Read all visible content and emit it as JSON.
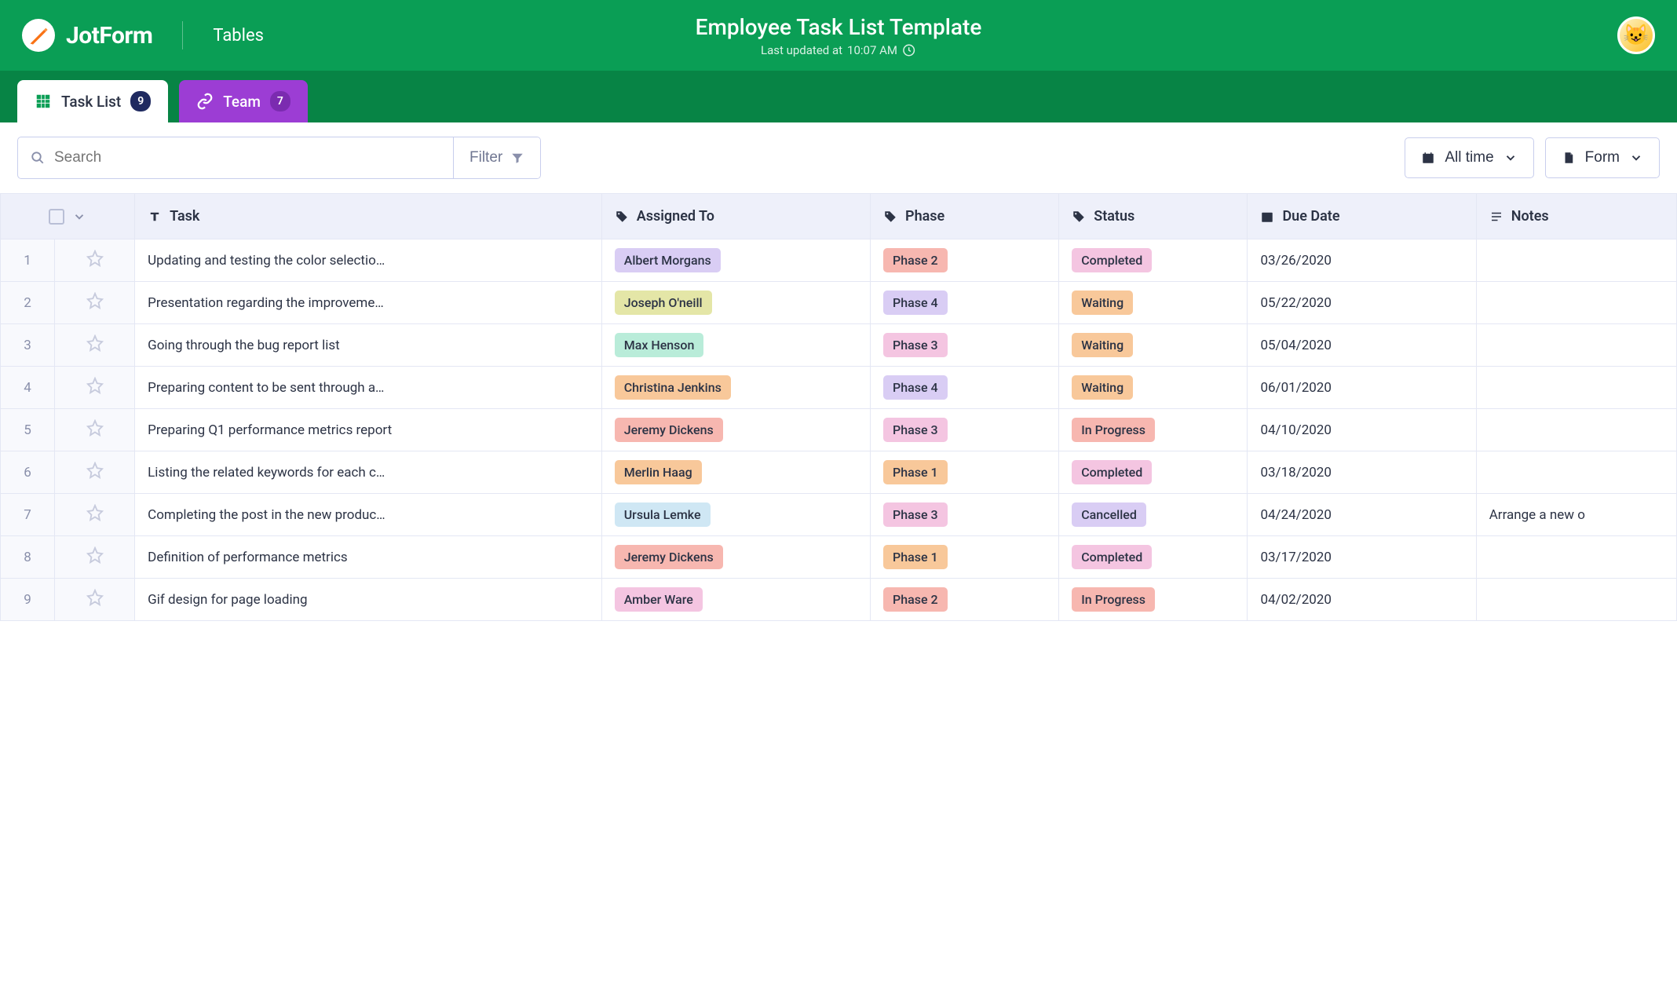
{
  "brand": {
    "name": "JotForm",
    "section": "Tables"
  },
  "header": {
    "title": "Employee Task List Template",
    "last_updated_prefix": "Last updated at ",
    "last_updated_time": "10:07 AM"
  },
  "tabs": {
    "task_list": {
      "label": "Task List",
      "count": "9"
    },
    "team": {
      "label": "Team",
      "count": "7"
    }
  },
  "toolbar": {
    "search_placeholder": "Search",
    "filter_label": "Filter",
    "timerange_label": "All time",
    "form_label": "Form"
  },
  "columns": {
    "task": "Task",
    "assigned_to": "Assigned To",
    "phase": "Phase",
    "status": "Status",
    "due_date": "Due Date",
    "notes": "Notes"
  },
  "colors": {
    "assignee": {
      "Albert Morgans": "#d9cdf4",
      "Joseph O'neill": "#e4e6a7",
      "Max Henson": "#b9ecd9",
      "Christina Jenkins": "#f8c89a",
      "Jeremy Dickens": "#f7b7b0",
      "Merlin Haag": "#f8c89a",
      "Ursula Lemke": "#cfe7f4",
      "Amber Ware": "#f4c5e1"
    },
    "phase": {
      "Phase 1": "#f8c89a",
      "Phase 2": "#f7b7b0",
      "Phase 3": "#f4c5e1",
      "Phase 4": "#d9cdf4"
    },
    "status": {
      "Completed": "#f4c5e1",
      "Waiting": "#f8c89a",
      "In Progress": "#f7b7b0",
      "Cancelled": "#d9cdf4"
    }
  },
  "rows": [
    {
      "idx": "1",
      "task": "Updating and testing the color selectio…",
      "assignee": "Albert Morgans",
      "phase": "Phase 2",
      "status": "Completed",
      "due": "03/26/2020",
      "notes": ""
    },
    {
      "idx": "2",
      "task": "Presentation regarding the improveme…",
      "assignee": "Joseph O'neill",
      "phase": "Phase 4",
      "status": "Waiting",
      "due": "05/22/2020",
      "notes": ""
    },
    {
      "idx": "3",
      "task": "Going through the bug report list",
      "assignee": "Max Henson",
      "phase": "Phase 3",
      "status": "Waiting",
      "due": "05/04/2020",
      "notes": ""
    },
    {
      "idx": "4",
      "task": "Preparing content to be sent through a…",
      "assignee": "Christina Jenkins",
      "phase": "Phase 4",
      "status": "Waiting",
      "due": "06/01/2020",
      "notes": ""
    },
    {
      "idx": "5",
      "task": "Preparing Q1 performance metrics report",
      "assignee": "Jeremy Dickens",
      "phase": "Phase 3",
      "status": "In Progress",
      "due": "04/10/2020",
      "notes": ""
    },
    {
      "idx": "6",
      "task": "Listing the related keywords for each c…",
      "assignee": "Merlin Haag",
      "phase": "Phase 1",
      "status": "Completed",
      "due": "03/18/2020",
      "notes": ""
    },
    {
      "idx": "7",
      "task": "Completing the post in the new produc…",
      "assignee": "Ursula Lemke",
      "phase": "Phase 3",
      "status": "Cancelled",
      "due": "04/24/2020",
      "notes": "Arrange a new o"
    },
    {
      "idx": "8",
      "task": "Definition of performance metrics",
      "assignee": "Jeremy Dickens",
      "phase": "Phase 1",
      "status": "Completed",
      "due": "03/17/2020",
      "notes": ""
    },
    {
      "idx": "9",
      "task": "Gif design for page loading",
      "assignee": "Amber Ware",
      "phase": "Phase 2",
      "status": "In Progress",
      "due": "04/02/2020",
      "notes": ""
    }
  ]
}
